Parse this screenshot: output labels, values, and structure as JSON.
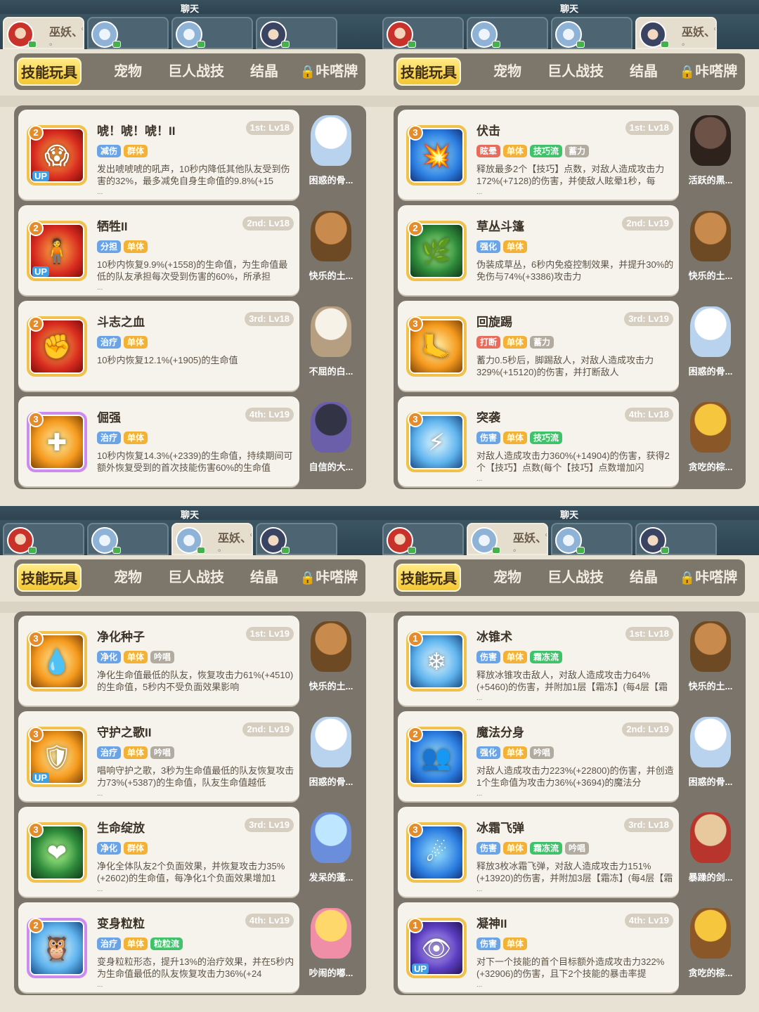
{
  "panels": [
    {
      "chat_label": "聊天",
      "characters": [
        {
          "avatar": "red",
          "name": "巫妖、",
          "dots": "∞",
          "sub": "。",
          "active": true
        },
        {
          "avatar": "blue",
          "name": "",
          "dots": "",
          "sub": "",
          "active": false
        },
        {
          "avatar": "blue",
          "name": "",
          "dots": "",
          "sub": "",
          "active": false
        },
        {
          "avatar": "dark",
          "name": "",
          "dots": "",
          "sub": "",
          "active": false
        }
      ],
      "tabs": [
        "技能玩具",
        "宠物",
        "巨人战技",
        "结晶",
        "咔嗒牌"
      ],
      "active_tab": 0,
      "cards": [
        {
          "name": "唬！唬！唬！II",
          "rank": "1st: Lv18",
          "level": "2",
          "frame": "gold",
          "color": "red",
          "glyph": "😱",
          "up": true,
          "tags": [
            {
              "text": "减伤",
              "c": "blue"
            },
            {
              "text": "群体",
              "c": "orange"
            }
          ],
          "desc": "发出唬唬唬的吼声，10秒内降低其他队友受到伤害的32%，最多减免自身生命值的9.8%(+15",
          "more": "...",
          "pet": "困惑的骨...",
          "pet_img": "white"
        },
        {
          "name": "牺牲II",
          "rank": "2nd: Lv18",
          "level": "2",
          "frame": "gold",
          "color": "red",
          "glyph": "🧍",
          "up": true,
          "tags": [
            {
              "text": "分担",
              "c": "blue"
            },
            {
              "text": "单体",
              "c": "orange"
            }
          ],
          "desc": "10秒内恢复9.9%(+1558)的生命值，为生命值最低的队友承担每次受到伤害的60%，所承担",
          "more": "...",
          "pet": "快乐的土...",
          "pet_img": "brown"
        },
        {
          "name": "斗志之血",
          "rank": "3rd: Lv18",
          "level": "2",
          "frame": "gold",
          "color": "red",
          "glyph": "✊",
          "up": false,
          "tags": [
            {
              "text": "治疗",
              "c": "blue"
            },
            {
              "text": "单体",
              "c": "orange"
            }
          ],
          "desc": "10秒内恢复12.1%(+1905)的生命值",
          "more": "",
          "pet": "不屈的白...",
          "pet_img": "goat"
        },
        {
          "name": "倔强",
          "rank": "4th: Lv19",
          "level": "3",
          "frame": "purple",
          "color": "gold",
          "glyph": "✚",
          "up": false,
          "tags": [
            {
              "text": "治疗",
              "c": "blue"
            },
            {
              "text": "单体",
              "c": "orange"
            }
          ],
          "desc": "10秒内恢复14.3%(+2339)的生命值，持续期间可额外恢复受到的首次技能伤害60%的生命值",
          "more": "",
          "pet": "自信的大...",
          "pet_img": "black"
        }
      ]
    },
    {
      "chat_label": "聊天",
      "characters": [
        {
          "avatar": "red",
          "name": "",
          "dots": "",
          "sub": "",
          "active": false
        },
        {
          "avatar": "blue",
          "name": "",
          "dots": "",
          "sub": "",
          "active": false
        },
        {
          "avatar": "blue",
          "name": "",
          "dots": "",
          "sub": "",
          "active": false
        },
        {
          "avatar": "dark",
          "name": "巫妖、",
          "dots": "∞",
          "sub": "。",
          "active": true
        }
      ],
      "tabs": [
        "技能玩具",
        "宠物",
        "巨人战技",
        "结晶",
        "咔嗒牌"
      ],
      "active_tab": 0,
      "cards": [
        {
          "name": "伏击",
          "rank": "1st: Lv18",
          "level": "3",
          "frame": "gold",
          "color": "blue",
          "glyph": "💥",
          "up": false,
          "tags": [
            {
              "text": "眩晕",
              "c": "red"
            },
            {
              "text": "单体",
              "c": "orange"
            },
            {
              "text": "技巧流",
              "c": "green"
            },
            {
              "text": "蓄力",
              "c": "grey"
            }
          ],
          "desc": "释放最多2个【技巧】点数，对敌人造成攻击力172%(+7128)的伤害，并使敌人眩晕1秒，每",
          "more": "...",
          "pet": "活跃的黑...",
          "pet_img": "pig"
        },
        {
          "name": "草丛斗篷",
          "rank": "2nd: Lv19",
          "level": "2",
          "frame": "gold",
          "color": "green",
          "glyph": "🌿",
          "up": false,
          "tags": [
            {
              "text": "强化",
              "c": "blue"
            },
            {
              "text": "单体",
              "c": "orange"
            }
          ],
          "desc": "伪装成草丛，6秒内免疫控制效果，并提升30%的免伤与74%(+3386)攻击力",
          "more": "",
          "pet": "快乐的土...",
          "pet_img": "brown"
        },
        {
          "name": "回旋踢",
          "rank": "3rd: Lv19",
          "level": "3",
          "frame": "gold",
          "color": "gold",
          "glyph": "🦶",
          "up": false,
          "tags": [
            {
              "text": "打断",
              "c": "red"
            },
            {
              "text": "单体",
              "c": "orange"
            },
            {
              "text": "蓄力",
              "c": "grey"
            }
          ],
          "desc": "蓄力0.5秒后，脚踢敌人，对敌人造成攻击力329%(+15120)的伤害，并打断敌人",
          "more": "",
          "pet": "困惑的骨...",
          "pet_img": "white"
        },
        {
          "name": "突袭",
          "rank": "4th: Lv18",
          "level": "3",
          "frame": "gold",
          "color": "ice",
          "glyph": "⚡",
          "up": false,
          "tags": [
            {
              "text": "伤害",
              "c": "blue"
            },
            {
              "text": "单体",
              "c": "orange"
            },
            {
              "text": "技巧流",
              "c": "green"
            }
          ],
          "desc": "对敌人造成攻击力360%(+14904)的伤害，获得2个【技巧】点数(每个【技巧】点数增加闪",
          "more": "...",
          "pet": "贪吃的棕...",
          "pet_img": "bee"
        }
      ]
    },
    {
      "chat_label": "聊天",
      "characters": [
        {
          "avatar": "red",
          "name": "",
          "dots": "",
          "sub": "",
          "active": false
        },
        {
          "avatar": "blue",
          "name": "",
          "dots": "",
          "sub": "",
          "active": false
        },
        {
          "avatar": "blue",
          "name": "巫妖、",
          "dots": "∞",
          "sub": "。",
          "active": true
        },
        {
          "avatar": "dark",
          "name": "",
          "dots": "",
          "sub": "",
          "active": false
        }
      ],
      "tabs": [
        "技能玩具",
        "宠物",
        "巨人战技",
        "结晶",
        "咔嗒牌"
      ],
      "active_tab": 0,
      "cards": [
        {
          "name": "净化种子",
          "rank": "1st: Lv19",
          "level": "3",
          "frame": "gold",
          "color": "gold",
          "glyph": "💧",
          "up": false,
          "tags": [
            {
              "text": "净化",
              "c": "blue"
            },
            {
              "text": "单体",
              "c": "orange"
            },
            {
              "text": "吟唱",
              "c": "grey"
            }
          ],
          "desc": "净化生命值最低的队友，恢复攻击力61%(+4510)的生命值，5秒内不受负面效果影响",
          "more": "",
          "pet": "快乐的土...",
          "pet_img": "brown"
        },
        {
          "name": "守护之歌II",
          "rank": "2nd: Lv19",
          "level": "3",
          "frame": "gold",
          "color": "gold",
          "glyph": "🛡",
          "up": true,
          "tags": [
            {
              "text": "治疗",
              "c": "blue"
            },
            {
              "text": "单体",
              "c": "orange"
            },
            {
              "text": "吟唱",
              "c": "grey"
            }
          ],
          "desc": "唱响守护之歌，3秒为生命值最低的队友恢复攻击力73%(+5387)的生命值，队友生命值越低",
          "more": "...",
          "pet": "困惑的骨...",
          "pet_img": "white"
        },
        {
          "name": "生命绽放",
          "rank": "3rd: Lv19",
          "level": "3",
          "frame": "gold",
          "color": "green",
          "glyph": "❤",
          "up": false,
          "tags": [
            {
              "text": "净化",
              "c": "blue"
            },
            {
              "text": "群体",
              "c": "orange"
            }
          ],
          "desc": "净化全体队友2个负面效果，并恢复攻击力35%(+2602)的生命值，每净化1个负面效果增加1",
          "more": "...",
          "pet": "发呆的蓬...",
          "pet_img": "blue"
        },
        {
          "name": "变身粒粒",
          "rank": "4th: Lv19",
          "level": "2",
          "frame": "purple",
          "color": "ice",
          "glyph": "🦉",
          "up": false,
          "tags": [
            {
              "text": "治疗",
              "c": "blue"
            },
            {
              "text": "单体",
              "c": "orange"
            },
            {
              "text": "粒粒流",
              "c": "green"
            }
          ],
          "desc": "变身粒粒形态，提升13%的治疗效果，并在5秒内为生命值最低的队友恢复攻击力36%(+24",
          "more": "...",
          "pet": "吵闹的嘟...",
          "pet_img": "bird"
        }
      ]
    },
    {
      "chat_label": "聊天",
      "characters": [
        {
          "avatar": "red",
          "name": "",
          "dots": "",
          "sub": "",
          "active": false
        },
        {
          "avatar": "blue",
          "name": "巫妖、",
          "dots": "∞",
          "sub": "。",
          "active": true
        },
        {
          "avatar": "blue",
          "name": "",
          "dots": "",
          "sub": "",
          "active": false
        },
        {
          "avatar": "dark",
          "name": "",
          "dots": "",
          "sub": "",
          "active": false
        }
      ],
      "tabs": [
        "技能玩具",
        "宠物",
        "巨人战技",
        "结晶",
        "咔嗒牌"
      ],
      "active_tab": 0,
      "cards": [
        {
          "name": "冰锥术",
          "rank": "1st: Lv18",
          "level": "1",
          "frame": "gold",
          "color": "ice",
          "glyph": "❄",
          "up": false,
          "tags": [
            {
              "text": "伤害",
              "c": "blue"
            },
            {
              "text": "单体",
              "c": "orange"
            },
            {
              "text": "霜冻流",
              "c": "green"
            }
          ],
          "desc": "释放冰锥攻击敌人，对敌人造成攻击力64%(+5460)的伤害，并附加1层【霜冻】(每4层【霜",
          "more": "...",
          "pet": "快乐的土...",
          "pet_img": "brown"
        },
        {
          "name": "魔法分身",
          "rank": "2nd: Lv19",
          "level": "2",
          "frame": "gold",
          "color": "blue",
          "glyph": "👥",
          "up": false,
          "tags": [
            {
              "text": "强化",
              "c": "blue"
            },
            {
              "text": "单体",
              "c": "orange"
            },
            {
              "text": "吟唱",
              "c": "grey"
            }
          ],
          "desc": "对敌人造成攻击力223%(+22800)的伤害，并创造1个生命值为攻击力36%(+3694)的魔法分",
          "more": "...",
          "pet": "困惑的骨...",
          "pet_img": "white"
        },
        {
          "name": "冰霜飞弹",
          "rank": "3rd: Lv18",
          "level": "3",
          "frame": "gold",
          "color": "blue",
          "glyph": "☄",
          "up": false,
          "tags": [
            {
              "text": "伤害",
              "c": "blue"
            },
            {
              "text": "单体",
              "c": "orange"
            },
            {
              "text": "霜冻流",
              "c": "green"
            },
            {
              "text": "吟唱",
              "c": "grey"
            }
          ],
          "desc": "释放3枚冰霜飞弹，对敌人造成攻击力151%(+13920)的伤害，并附加3层【霜冻】(每4层【霜",
          "more": "...",
          "pet": "暴躁的剑...",
          "pet_img": "samurai"
        },
        {
          "name": "凝神II",
          "rank": "4th: Lv19",
          "level": "1",
          "frame": "gold",
          "color": "violet",
          "glyph": "👁",
          "up": true,
          "tags": [
            {
              "text": "伤害",
              "c": "blue"
            },
            {
              "text": "单体",
              "c": "orange"
            }
          ],
          "desc": "对下一个技能的首个目标额外造成攻击力322%(+32906)的伤害，且下2个技能的暴击率提",
          "more": "...",
          "pet": "贪吃的棕...",
          "pet_img": "bee"
        }
      ]
    }
  ]
}
